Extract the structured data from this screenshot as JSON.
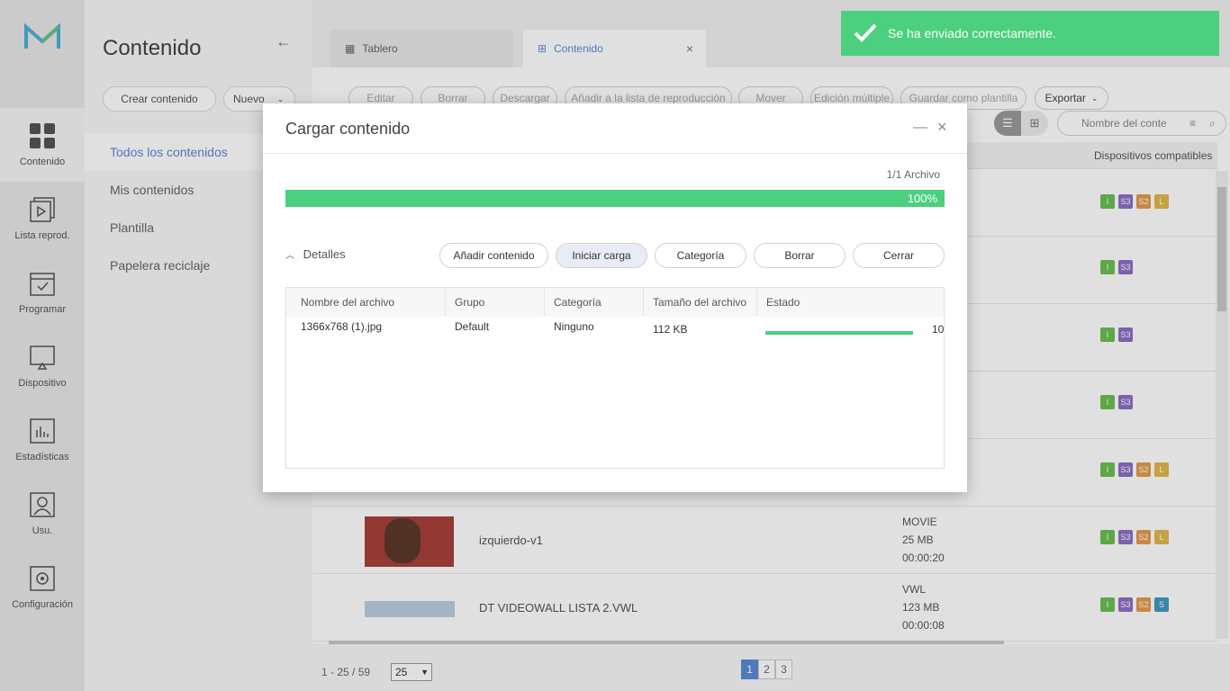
{
  "rail": {
    "items": [
      {
        "label": "Contenido",
        "icon": "grid-icon"
      },
      {
        "label": "Lista reprod.",
        "icon": "playlist-icon"
      },
      {
        "label": "Programar",
        "icon": "calendar-icon"
      },
      {
        "label": "Dispositivo",
        "icon": "monitor-icon"
      },
      {
        "label": "Estadísticas",
        "icon": "chart-icon"
      },
      {
        "label": "Usu.",
        "icon": "user-icon"
      },
      {
        "label": "Configuración",
        "icon": "gear-icon"
      }
    ]
  },
  "sidebar": {
    "title": "Contenido",
    "create_label": "Crear contenido",
    "new_label": "Nuevo",
    "menu": [
      "Todos los contenidos",
      "Mis contenidos",
      "Plantilla",
      "Papelera reciclaje"
    ]
  },
  "tabs": [
    {
      "label": "Tablero"
    },
    {
      "label": "Contenido"
    }
  ],
  "toolbar": {
    "buttons": [
      "Editar",
      "Borrar",
      "Descargar",
      "Añadir a la lista de reproducción",
      "Mover",
      "Edición múltiple",
      "Guardar como plantilla",
      "Exportar"
    ],
    "search_placeholder": "Nombre del conte"
  },
  "table_header": {
    "devices": "Dispositivos compatibles"
  },
  "content_rows": [
    {
      "name": "izquierdo-v1",
      "type": "MOVIE",
      "size": "25 MB",
      "duration": "00:00:20",
      "badges": [
        "I",
        "S3",
        "S2",
        "L"
      ]
    },
    {
      "name": "DT VIDEOWALL LISTA 2.VWL",
      "type": "VWL",
      "size": "123 MB",
      "duration": "00:00:08",
      "badges": [
        "I",
        "S3",
        "S2",
        "S"
      ]
    }
  ],
  "pagination": {
    "range": "1 - 25 / 59",
    "per_page": "25",
    "pages": [
      "1",
      "2",
      "3"
    ]
  },
  "modal": {
    "title": "Cargar contenido",
    "count": "1/1 Archivo",
    "progress": "100%",
    "details_label": "Detalles",
    "buttons": [
      "Añadir contenido",
      "Iniciar carga",
      "Categoría",
      "Borrar",
      "Cerrar"
    ],
    "columns": [
      "Nombre del archivo",
      "Grupo",
      "Categoría",
      "Tamaño del archivo",
      "Estado"
    ],
    "files": [
      {
        "name": "1366x768 (1).jpg",
        "group": "Default",
        "category": "Ninguno",
        "size": "112 KB",
        "status": "10"
      }
    ]
  },
  "toast": {
    "message": "Se ha enviado correctamente."
  },
  "colors": {
    "accent": "#5a8ad8",
    "success": "#4ccf7e"
  }
}
